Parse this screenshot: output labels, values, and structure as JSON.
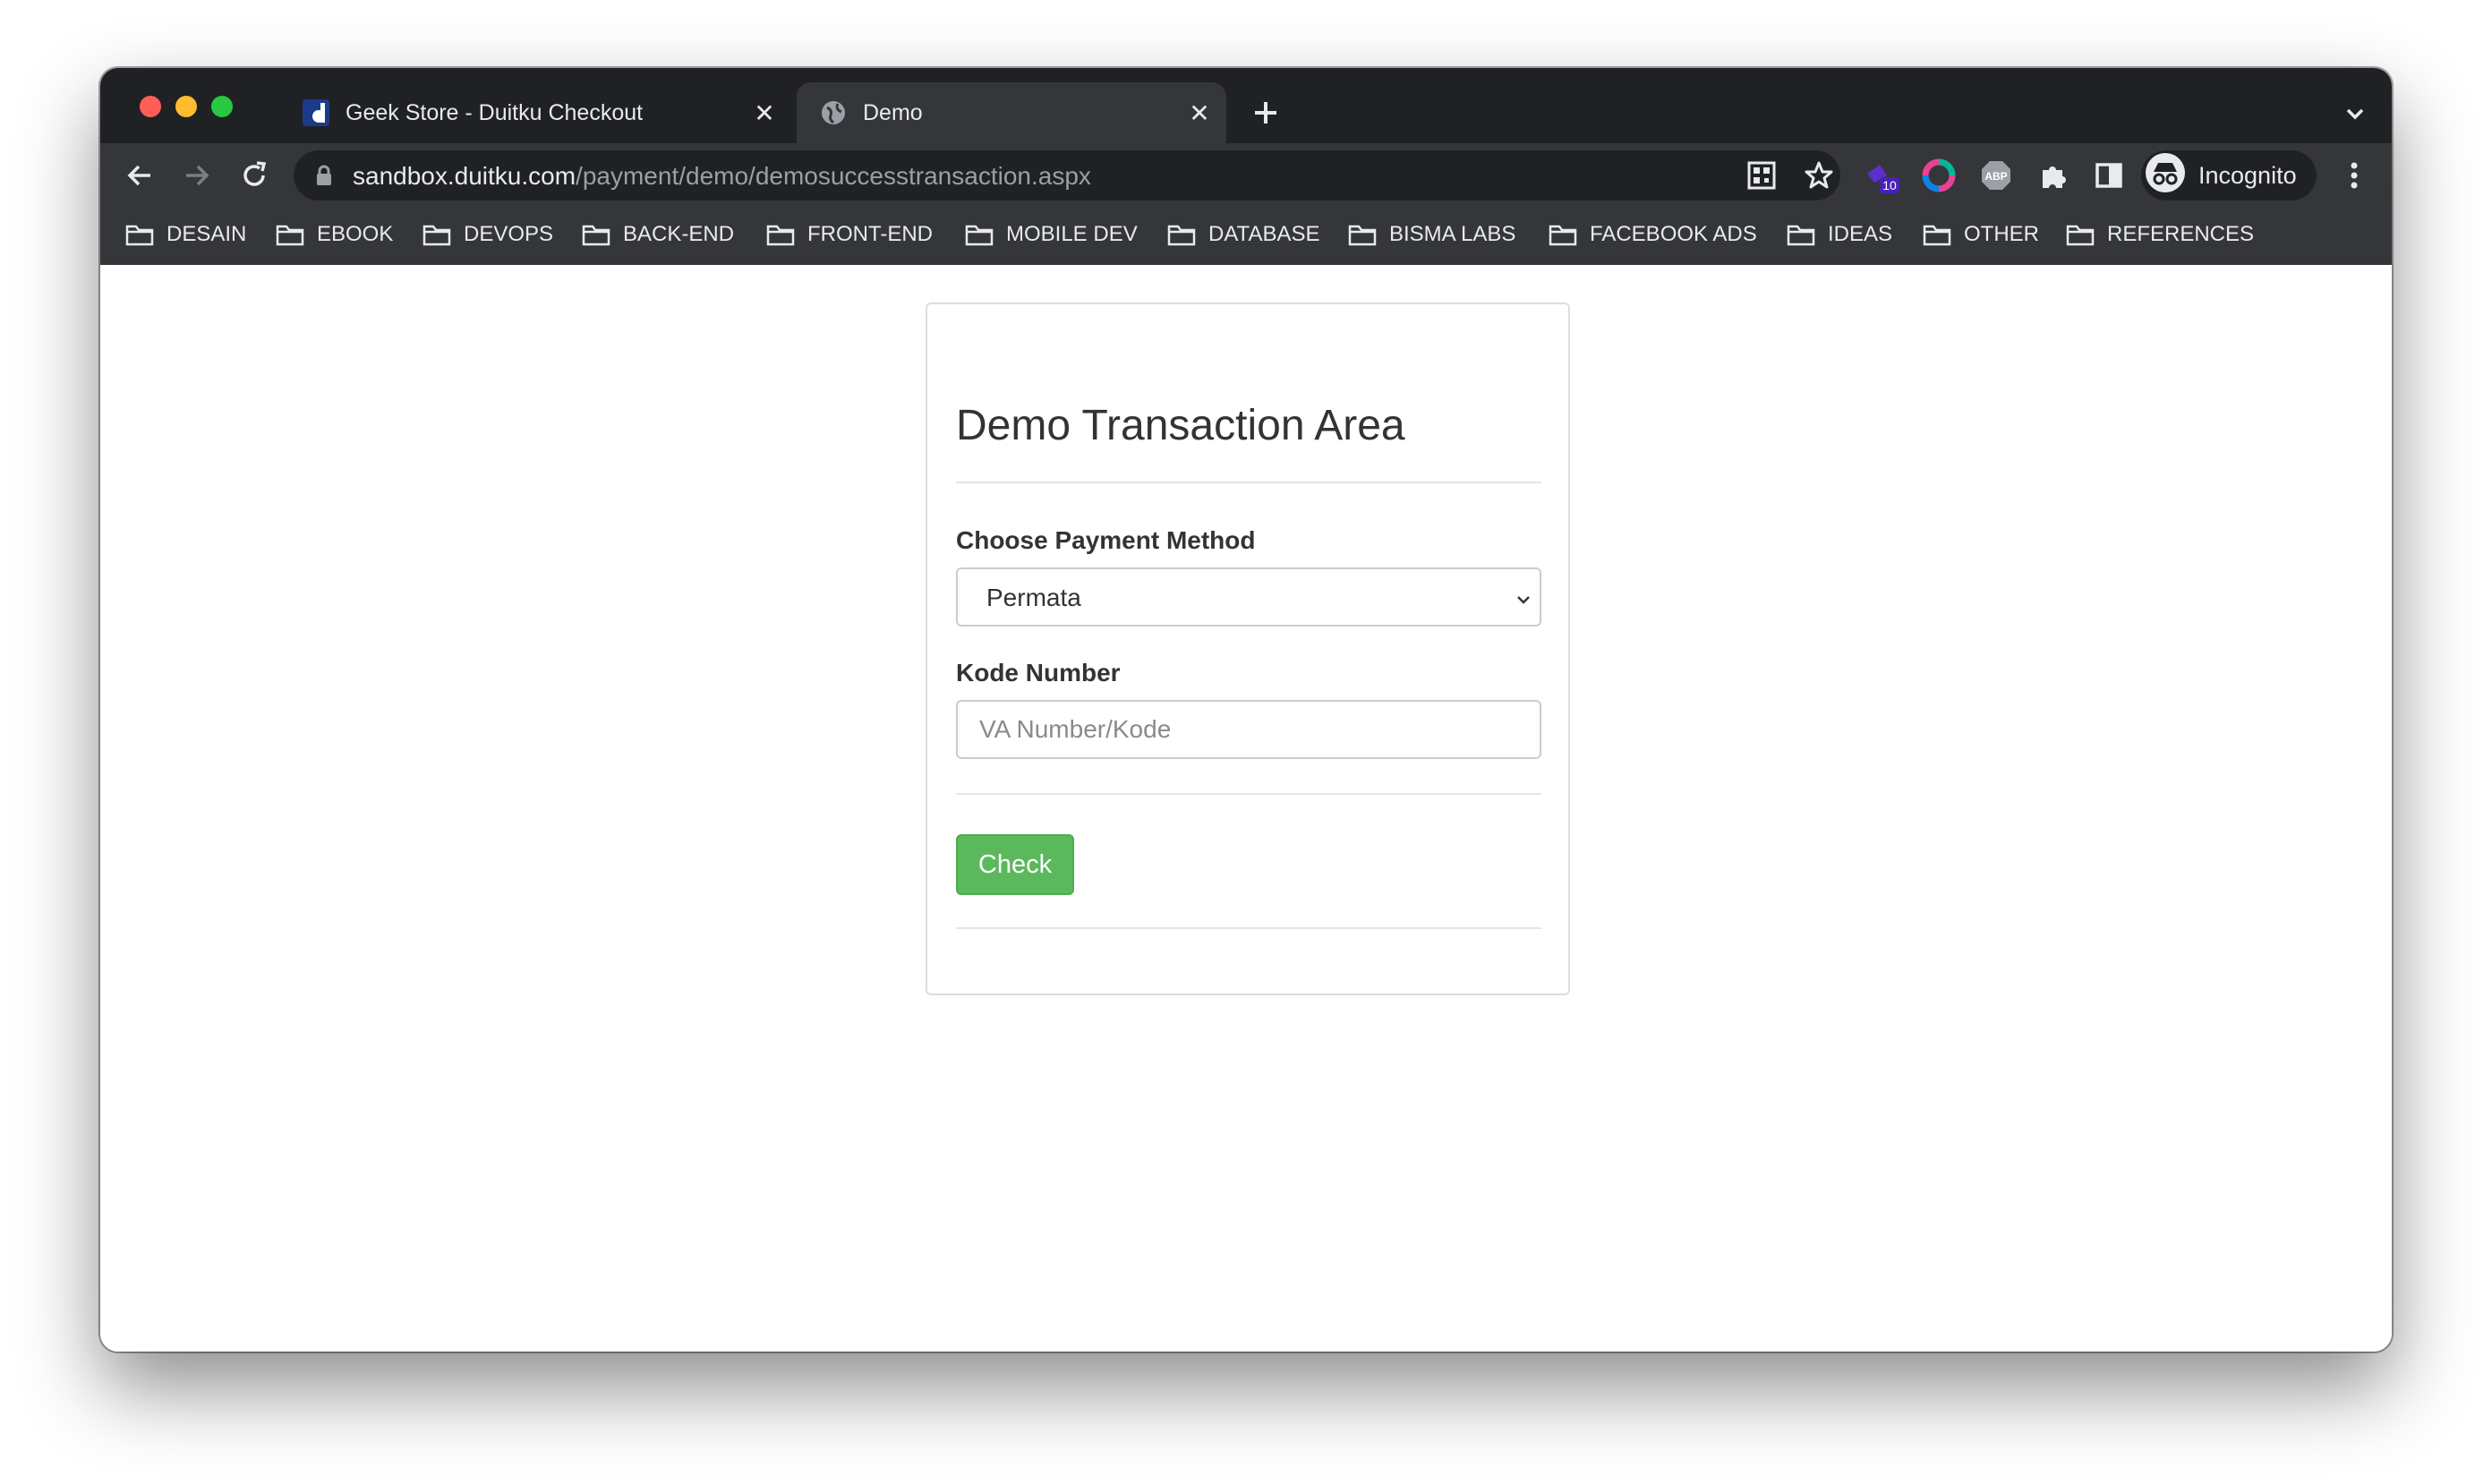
{
  "browser": {
    "tabs": [
      {
        "title": "Geek Store - Duitku Checkout",
        "active": false
      },
      {
        "title": "Demo",
        "active": true
      }
    ],
    "url_host": "sandbox.duitku.com",
    "url_path": "/payment/demo/demosuccesstransaction.aspx",
    "profile_label": "Incognito",
    "extension_badge": "10",
    "bookmarks": [
      "DESAIN",
      "EBOOK",
      "DEVOPS",
      "BACK-END",
      "FRONT-END",
      "MOBILE DEV",
      "DATABASE",
      "BISMA LABS",
      "FACEBOOK ADS",
      "IDEAS",
      "OTHER",
      "REFERENCES"
    ]
  },
  "page": {
    "heading": "Demo Transaction Area",
    "payment_method_label": "Choose Payment Method",
    "payment_method_value": "Permata",
    "kode_label": "Kode Number",
    "kode_placeholder": "VA Number/Kode",
    "kode_value": "",
    "check_button": "Check"
  },
  "colors": {
    "chrome_dark": "#202124",
    "chrome_toolbar": "#35363a",
    "button_green": "#5cb85c"
  },
  "icons": [
    "close-window",
    "minimize-window",
    "zoom-window",
    "duitku-favicon",
    "globe-icon",
    "close-icon",
    "plus-icon",
    "chevron-down-icon",
    "back-arrow-icon",
    "forward-arrow-icon",
    "reload-icon",
    "lock-icon",
    "qr-icon",
    "star-icon",
    "extension-icon",
    "color-wheel-icon",
    "abp-icon",
    "puzzle-icon",
    "sidebar-icon",
    "incognito-icon",
    "kebab-menu-icon",
    "folder-icon"
  ]
}
